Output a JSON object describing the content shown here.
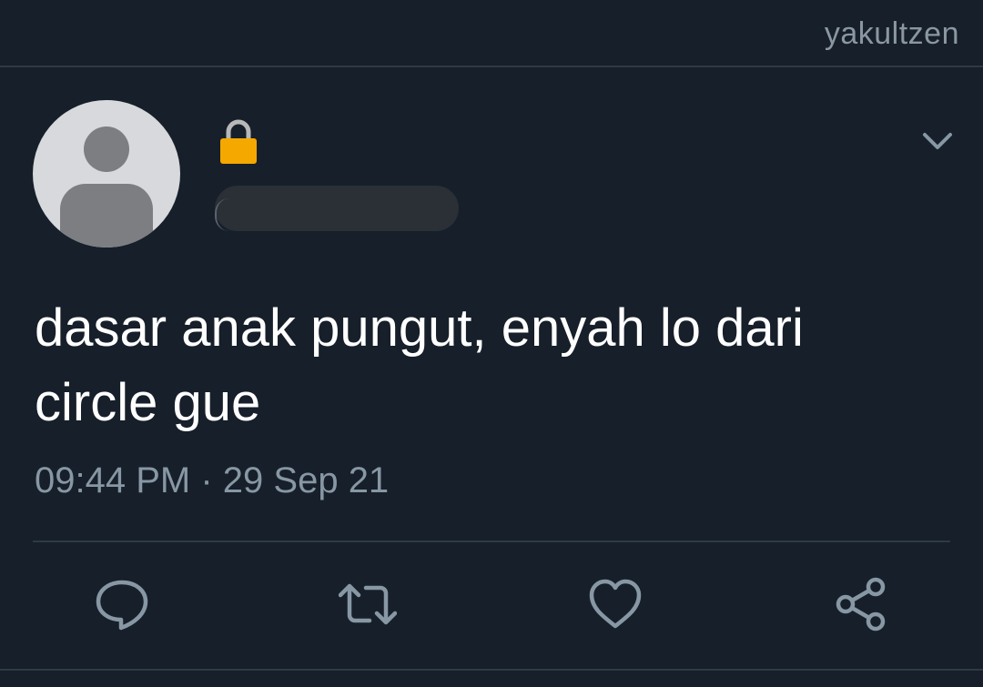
{
  "watermark": "yakultzen",
  "tweet": {
    "text_line1": "dasar anak pungut, enyah lo dari",
    "text_line2": "circle gue",
    "time": "09:44 PM",
    "separator": "·",
    "date": "29 Sep 21"
  },
  "icons": {
    "lock": "lock-icon",
    "menu": "chevron-down-icon",
    "reply": "reply-icon",
    "retweet": "retweet-icon",
    "like": "heart-icon",
    "share": "share-icon"
  },
  "colors": {
    "background": "#161f2a",
    "icon": "#8797a4",
    "lock": "#f5a800"
  }
}
